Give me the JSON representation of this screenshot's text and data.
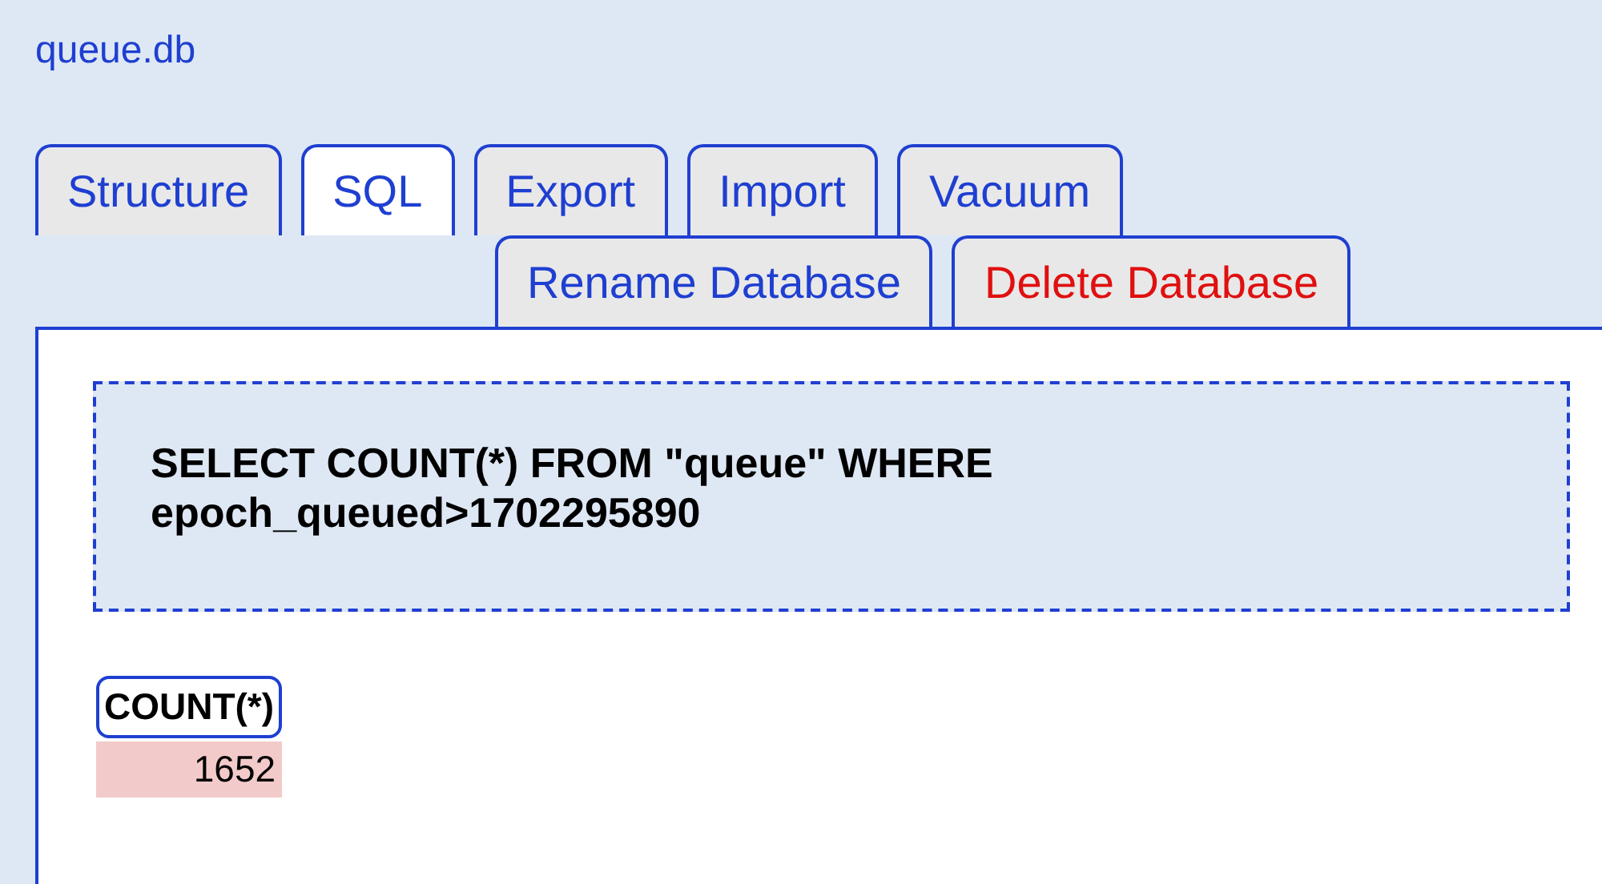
{
  "database": {
    "title": "queue.db"
  },
  "tab_rows": [
    [
      {
        "label": "Structure",
        "selected": false,
        "kind": "normal"
      },
      {
        "label": "SQL",
        "selected": true,
        "kind": "normal"
      },
      {
        "label": "Export",
        "selected": false,
        "kind": "normal"
      },
      {
        "label": "Import",
        "selected": false,
        "kind": "normal"
      },
      {
        "label": "Vacuum",
        "selected": false,
        "kind": "normal"
      }
    ],
    [
      {
        "label": "Rename Database",
        "selected": false,
        "kind": "normal"
      },
      {
        "label": "Delete Database",
        "selected": false,
        "kind": "danger"
      }
    ]
  ],
  "query": {
    "text": "SELECT COUNT(*) FROM \"queue\" WHERE epoch_queued>1702295890"
  },
  "result": {
    "columns": [
      "COUNT(*)"
    ],
    "rows": [
      [
        "1652"
      ]
    ]
  }
}
